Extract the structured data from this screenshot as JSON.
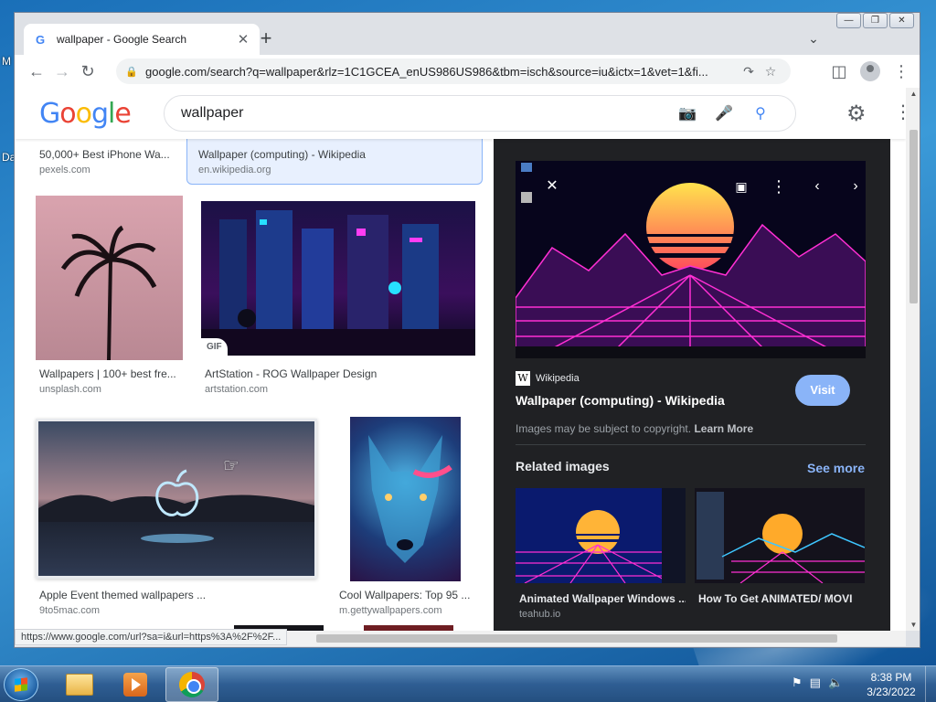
{
  "window": {
    "tab_title": "wallpaper - Google Search",
    "tab_favicon": "G",
    "tab_close": "✕",
    "new_tab": "+",
    "url": "google.com/search?q=wallpaper&rlz=1C1GCEA_enUS986US986&tbm=isch&source=iu&ictx=1&vet=1&fi..."
  },
  "google": {
    "logo": [
      "G",
      "o",
      "o",
      "g",
      "l",
      "e"
    ],
    "logo_colors": [
      "#4285f4",
      "#ea4335",
      "#fbbc05",
      "#4285f4",
      "#34a853",
      "#ea4335"
    ],
    "query": "wallpaper"
  },
  "results": [
    {
      "caption": "50,000+ Best iPhone Wa...",
      "source": "pexels.com"
    },
    {
      "caption": "Wallpaper (computing) - Wikipedia",
      "source": "en.wikipedia.org"
    },
    {
      "caption": "Wallpapers | 100+ best fre...",
      "source": "unsplash.com"
    },
    {
      "caption": "ArtStation - ROG Wallpaper Design",
      "source": "artstation.com",
      "badge": "GIF"
    },
    {
      "caption": "Apple Event themed wallpapers ...",
      "source": "9to5mac.com"
    },
    {
      "caption": "Cool Wallpapers: Top 95 ...",
      "source": "m.gettywallpapers.com"
    }
  ],
  "panel": {
    "source_name": "Wikipedia",
    "source_icon": "W",
    "title": "Wallpaper (computing) - Wikipedia",
    "visit_label": "Visit",
    "copyright_text": "Images may be subject to copyright.",
    "learn_more": "Learn More",
    "related_label": "Related images",
    "see_more": "See more",
    "related": [
      {
        "caption": "Animated Wallpaper Windows ...",
        "source": "teahub.io"
      },
      {
        "caption": "How To Get ANIMATED/ MOVI",
        "source": ""
      }
    ]
  },
  "status_url": "https://www.google.com/url?sa=i&url=https%3A%2F%2F...",
  "taskbar": {
    "time": "8:38 PM",
    "date": "3/23/2022"
  }
}
